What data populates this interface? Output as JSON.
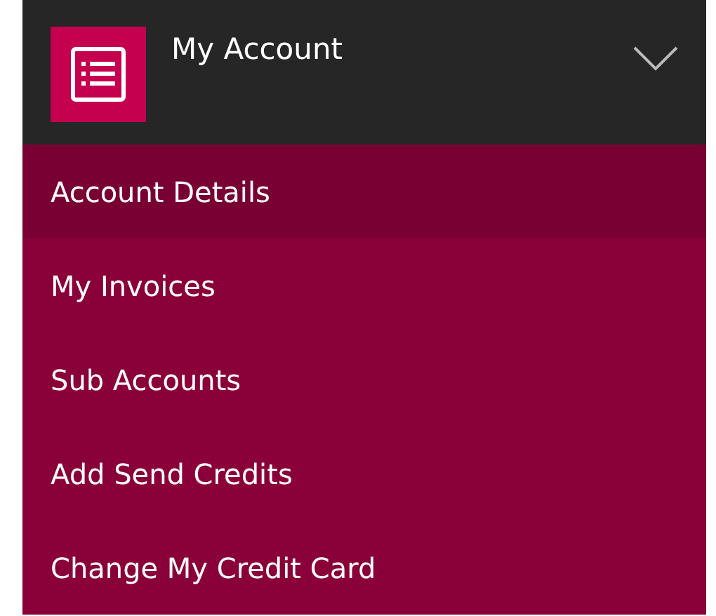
{
  "header": {
    "title": "My Account",
    "expanded": true
  },
  "menu": [
    {
      "label": "Account Details",
      "selected": true
    },
    {
      "label": "My Invoices",
      "selected": false
    },
    {
      "label": "Sub Accounts",
      "selected": false
    },
    {
      "label": "Add Send Credits",
      "selected": false
    },
    {
      "label": "Change My Credit Card",
      "selected": false
    }
  ]
}
